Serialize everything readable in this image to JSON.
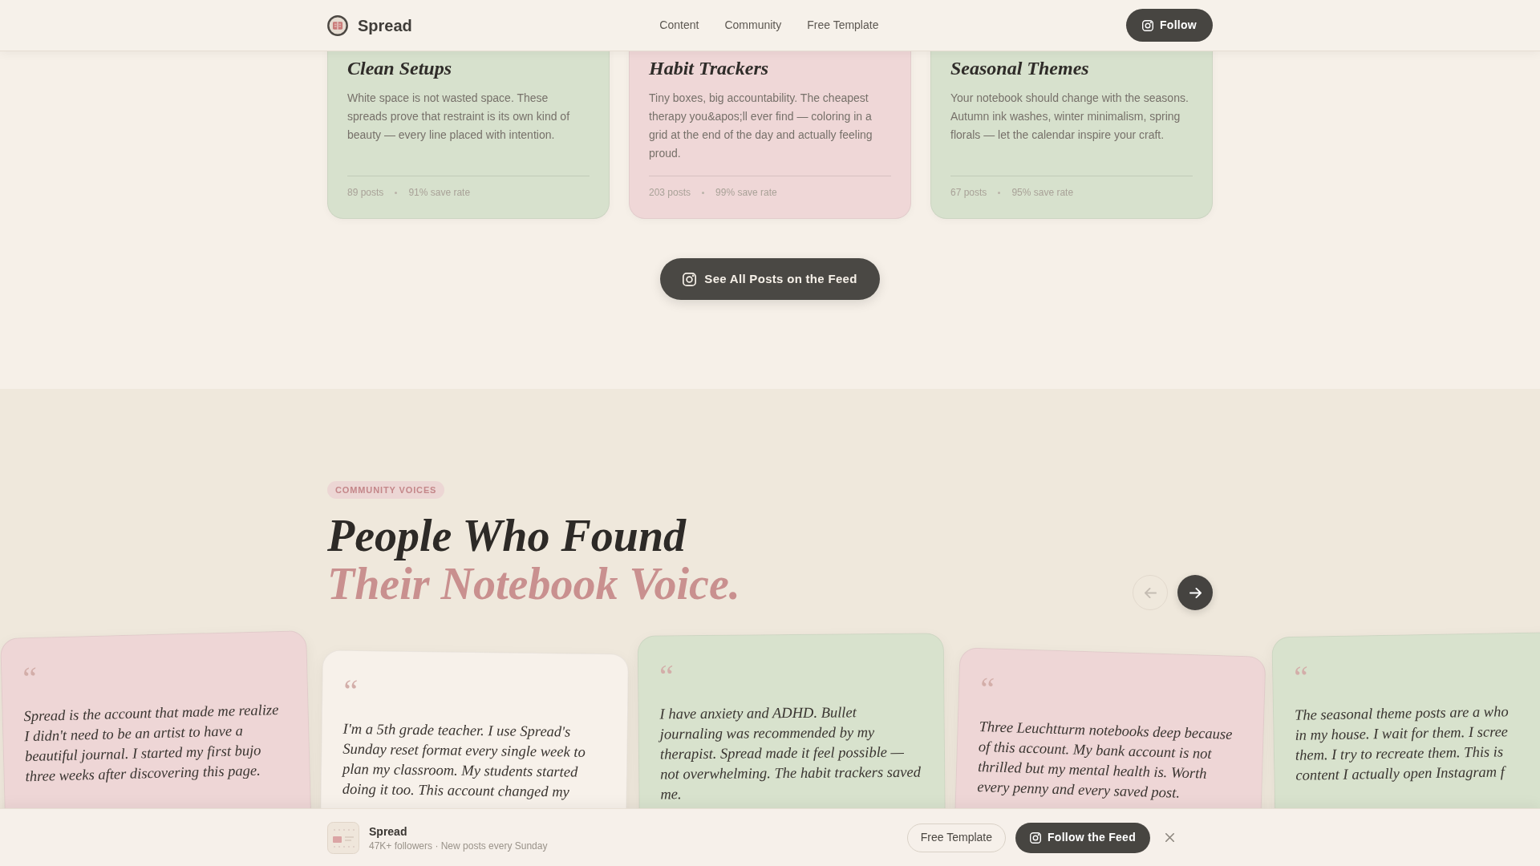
{
  "nav": {
    "brand": "Spread",
    "links": [
      {
        "label": "Content"
      },
      {
        "label": "Community"
      },
      {
        "label": "Free Template"
      }
    ],
    "follow_button": {
      "label": "Follow"
    }
  },
  "categories": [
    {
      "title": "Clean Setups",
      "description": "White space is not wasted space. These spreads prove that restraint is its own kind of beauty — every line placed with intention.",
      "posts": "89 posts",
      "save_rate": "91% save rate",
      "color": "#d7e1cd"
    },
    {
      "title": "Habit Trackers",
      "description": "Tiny boxes, big accountability. The cheapest therapy you&apos;ll ever find — coloring in a grid at the end of the day and actually feeling proud.",
      "posts": "203 posts",
      "save_rate": "99% save rate",
      "color": "#efd7d7"
    },
    {
      "title": "Seasonal Themes",
      "description": "Your notebook should change with the seasons. Autumn ink washes, winter minimalism, spring florals — let the calendar inspire your craft.",
      "posts": "67 posts",
      "save_rate": "95% save rate",
      "color": "#d7e1cd"
    }
  ],
  "feed_button": {
    "label": "See All Posts on the Feed"
  },
  "voices": {
    "badge": "COMMUNITY VOICES",
    "heading": {
      "line_1": "People Who Found",
      "line_2": "Their Notebook Voice."
    },
    "controls": [
      {
        "kind": "previous",
        "disabled": true
      },
      {
        "kind": "next",
        "disabled": false
      }
    ]
  },
  "testimonials": [
    {
      "mark": "“",
      "lines": [
        "Spread is the account that made me realize",
        "I didn't need to be an artist to have a",
        "beautiful journal. I started my first bujo",
        "three weeks after discovering this page."
      ],
      "color": "#eed6d6"
    },
    {
      "mark": "“",
      "lines": [
        "I'm a 5th grade teacher. I use Spread's",
        "Sunday reset format every single week to",
        "plan my classroom. My students started",
        "doing it too. This account changed my"
      ],
      "color": "#f7f1ea"
    },
    {
      "mark": "“",
      "lines": [
        "I have anxiety and ADHD. Bullet",
        "journaling was recommended by my",
        "therapist. Spread made it feel possible —",
        "not overwhelming. The habit trackers saved",
        "me."
      ],
      "color": "#d8e2cd"
    },
    {
      "mark": "“",
      "lines": [
        "Three Leuchtturm notebooks deep because",
        "of this account. My bank account is not",
        "thrilled but my mental health is. Worth",
        "every penny and every saved post."
      ],
      "color": "#eed6d6"
    },
    {
      "mark": "“",
      "lines": [
        "The seasonal theme posts are a who",
        "in my house. I wait for them. I scree",
        "them. I try to recreate them. This is",
        "content I actually open Instagram f"
      ],
      "color": "#d8e2cd"
    }
  ],
  "sticky_bar": {
    "name": "Spread",
    "summary": "47K+ followers · New posts every Sunday",
    "buttons": [
      {
        "kind": "outline",
        "label": "Free Template"
      },
      {
        "kind": "primary",
        "label": "Follow the Feed"
      }
    ]
  }
}
